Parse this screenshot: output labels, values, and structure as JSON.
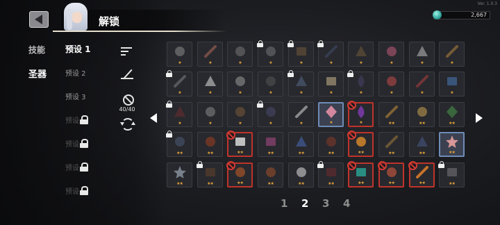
{
  "header": {
    "title": "解锁",
    "version": "Ver. 1.0.3",
    "currency": "2,667",
    "back_icon": "back-arrow-icon",
    "currency_icon": "gem-icon"
  },
  "categories": [
    {
      "label": "技能",
      "active": false
    },
    {
      "label": "圣器",
      "active": true
    }
  ],
  "presets": [
    {
      "label": "预设 1",
      "active": true,
      "locked": false
    },
    {
      "label": "预设 2",
      "active": false,
      "locked": false
    },
    {
      "label": "预设 3",
      "active": false,
      "locked": false
    },
    {
      "label": "预设",
      "active": false,
      "locked": true
    },
    {
      "label": "预设",
      "active": false,
      "locked": true
    },
    {
      "label": "预设",
      "active": false,
      "locked": true
    },
    {
      "label": "预设",
      "active": false,
      "locked": true
    }
  ],
  "tools": {
    "count": "40/40",
    "sort_icon": "sort-icon",
    "filter_icon": "filter-icon",
    "ban_icon": "no-entry-icon",
    "refresh_icon": "refresh-icon"
  },
  "grid": {
    "rows": [
      [
        {
          "stars": "★",
          "state": "normal",
          "icon": "mask-icon",
          "color": "#8a8a8a"
        },
        {
          "stars": "★",
          "state": "normal",
          "icon": "feather-icon",
          "color": "#b06a5a"
        },
        {
          "stars": "★",
          "state": "normal",
          "icon": "helmet-icon",
          "color": "#777777"
        },
        {
          "stars": "★",
          "state": "locked",
          "icon": "orb-icon",
          "color": "#bdbdbd"
        },
        {
          "stars": "★",
          "state": "locked",
          "icon": "scroll-icon",
          "color": "#b9884a"
        },
        {
          "stars": "★",
          "state": "locked",
          "icon": "quill-icon",
          "color": "#5e6ea8"
        },
        {
          "stars": "★",
          "state": "normal",
          "icon": "hat-icon",
          "color": "#6f5a3a"
        },
        {
          "stars": "★",
          "state": "normal",
          "icon": "eye-icon",
          "color": "#c25b7a"
        },
        {
          "stars": "★",
          "state": "normal",
          "icon": "claw-icon",
          "color": "#bdbdbd"
        },
        {
          "stars": "★",
          "state": "normal",
          "icon": "pipe-icon",
          "color": "#b58440"
        }
      ],
      [
        {
          "stars": "★",
          "state": "locked",
          "icon": "fang-icon",
          "color": "#d0d0d0"
        },
        {
          "stars": "★",
          "state": "normal",
          "icon": "fan-icon",
          "color": "#e0e0e0"
        },
        {
          "stars": "★",
          "state": "normal",
          "icon": "gauntlet-icon",
          "color": "#9a9a9a"
        },
        {
          "stars": "★",
          "state": "normal",
          "icon": "pan-icon",
          "color": "#555555"
        },
        {
          "stars": "★",
          "state": "locked",
          "icon": "crescent-icon",
          "color": "#7fa3d8"
        },
        {
          "stars": "★",
          "state": "normal",
          "icon": "book-icon",
          "color": "#c8b48c"
        },
        {
          "stars": "★",
          "state": "locked",
          "icon": "potion-icon",
          "color": "#6a5aa0"
        },
        {
          "stars": "★",
          "state": "normal",
          "icon": "shield-icon",
          "color": "#c24a4a"
        },
        {
          "stars": "★",
          "state": "normal",
          "icon": "wand-icon",
          "color": "#b04040"
        },
        {
          "stars": "★",
          "state": "normal",
          "icon": "flag-icon",
          "color": "#4a7ab8"
        }
      ],
      [
        {
          "stars": "★",
          "state": "locked",
          "icon": "leaf-icon",
          "color": "#b03030"
        },
        {
          "stars": "★",
          "state": "normal",
          "icon": "goggles-icon",
          "color": "#888888"
        },
        {
          "stars": "★",
          "state": "normal",
          "icon": "dot-icon",
          "color": "#7a5a3a"
        },
        {
          "stars": "★",
          "state": "locked",
          "icon": "ring-icon",
          "color": "#6a6aa8"
        },
        {
          "stars": "★",
          "state": "normal",
          "icon": "bone-icon",
          "color": "#d8d8d8"
        },
        {
          "stars": "★",
          "state": "selected",
          "icon": "crystal-icon",
          "color": "#e38fa8"
        },
        {
          "stars": "★",
          "state": "banned",
          "icon": "eggplant-icon",
          "color": "#7a3aa8"
        },
        {
          "stars": "★★",
          "state": "normal",
          "icon": "sword-icon",
          "color": "#c7903a"
        },
        {
          "stars": "★★",
          "state": "normal",
          "icon": "fist-icon",
          "color": "#c8a050"
        },
        {
          "stars": "★★",
          "state": "normal",
          "icon": "tablet-icon",
          "color": "#4a9a4a"
        }
      ],
      [
        {
          "stars": "★★",
          "state": "locked",
          "icon": "armor-icon",
          "color": "#6a8ab8"
        },
        {
          "stars": "★★",
          "state": "normal",
          "icon": "rune-disc-icon",
          "color": "#a04020"
        },
        {
          "stars": "★★",
          "state": "banned",
          "icon": "dice-icon",
          "color": "#d0d0d0"
        },
        {
          "stars": "★★",
          "state": "normal",
          "icon": "spellbook-icon",
          "color": "#b04a8a"
        },
        {
          "stars": "★★",
          "state": "normal",
          "icon": "wings-icon",
          "color": "#4a6ab8"
        },
        {
          "stars": "★★",
          "state": "normal",
          "icon": "vest-icon",
          "color": "#8a3a2a"
        },
        {
          "stars": "★★",
          "state": "banned",
          "icon": "coin-icon",
          "color": "#c8802a"
        },
        {
          "stars": "★★",
          "state": "normal",
          "icon": "dagger-icon",
          "color": "#a07a3a"
        },
        {
          "stars": "★★",
          "state": "normal",
          "icon": "cape-icon",
          "color": "#4a5a8a"
        },
        {
          "stars": "★★",
          "state": "selected",
          "icon": "key-icon",
          "color": "#e8a0a0"
        }
      ],
      [
        {
          "stars": "★★",
          "state": "normal",
          "icon": "snowflake-icon",
          "color": "#b8c8d8"
        },
        {
          "stars": "★★",
          "state": "locked",
          "icon": "chest-icon",
          "color": "#a05a2a"
        },
        {
          "stars": "★★",
          "state": "banned",
          "icon": "boot-icon",
          "color": "#8a4a2a"
        },
        {
          "stars": "★★",
          "state": "normal",
          "icon": "hourglass-icon",
          "color": "#a0502a"
        },
        {
          "stars": "★★",
          "state": "normal",
          "icon": "skull-icon",
          "color": "#e0e0e0"
        },
        {
          "stars": "★★",
          "state": "locked",
          "icon": "banner-icon",
          "color": "#b03030"
        },
        {
          "stars": "★★",
          "state": "banned",
          "icon": "jar-icon",
          "color": "#2a9a8a"
        },
        {
          "stars": "★★",
          "state": "banned",
          "icon": "plate-icon",
          "color": "#9a4a3a"
        },
        {
          "stars": "★★",
          "state": "banned",
          "icon": "carrot-icon",
          "color": "#d87a2a"
        },
        {
          "stars": "★★",
          "state": "locked",
          "icon": "map-icon",
          "color": "#c8c8c8"
        }
      ]
    ]
  },
  "pages": {
    "items": [
      "1",
      "2",
      "3",
      "4"
    ],
    "active_index": 1,
    "prev_icon": "arrow-left-icon",
    "next_icon": "arrow-right-icon"
  }
}
